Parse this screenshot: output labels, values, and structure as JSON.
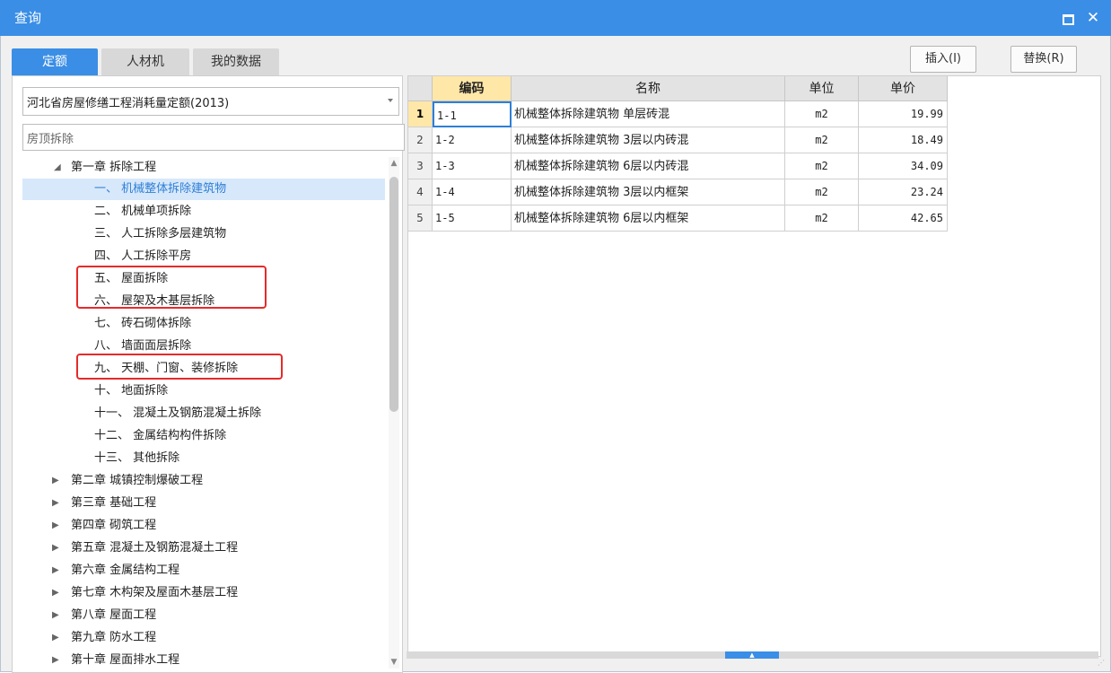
{
  "window": {
    "title": "查询"
  },
  "tabs": [
    {
      "label": "定额",
      "active": true
    },
    {
      "label": "人材机",
      "active": false
    },
    {
      "label": "我的数据",
      "active": false
    }
  ],
  "buttons": {
    "insert": "插入(I)",
    "replace": "替换(R)"
  },
  "quota_library": {
    "selected": "河北省房屋修缮工程消耗量定额(2013)"
  },
  "search": {
    "value": "房顶拆除"
  },
  "tree": {
    "chapter1": "第一章 拆除工程",
    "sections": [
      "一、 机械整体拆除建筑物",
      "二、 机械单项拆除",
      "三、 人工拆除多层建筑物",
      "四、 人工拆除平房",
      "五、 屋面拆除",
      "六、 屋架及木基层拆除",
      "七、 砖石砌体拆除",
      "八、 墙面面层拆除",
      "九、 天棚、门窗、装修拆除",
      "十、 地面拆除",
      "十一、 混凝土及钢筋混凝土拆除",
      "十二、 金属结构构件拆除",
      "十三、 其他拆除"
    ],
    "chapters": [
      "第二章 城镇控制爆破工程",
      "第三章 基础工程",
      "第四章 砌筑工程",
      "第五章 混凝土及钢筋混凝土工程",
      "第六章 金属结构工程",
      "第七章 木构架及屋面木基层工程",
      "第八章 屋面工程",
      "第九章 防水工程",
      "第十章 屋面排水工程"
    ]
  },
  "table": {
    "headers": [
      "编码",
      "名称",
      "单位",
      "单价"
    ],
    "rows": [
      {
        "n": "1",
        "code": "1-1",
        "name": "机械整体拆除建筑物 单层砖混",
        "unit": "m2",
        "price": "19.99"
      },
      {
        "n": "2",
        "code": "1-2",
        "name": "机械整体拆除建筑物 3层以内砖混",
        "unit": "m2",
        "price": "18.49"
      },
      {
        "n": "3",
        "code": "1-3",
        "name": "机械整体拆除建筑物 6层以内砖混",
        "unit": "m2",
        "price": "34.09"
      },
      {
        "n": "4",
        "code": "1-4",
        "name": "机械整体拆除建筑物 3层以内框架",
        "unit": "m2",
        "price": "23.24"
      },
      {
        "n": "5",
        "code": "1-5",
        "name": "机械整体拆除建筑物 6层以内框架",
        "unit": "m2",
        "price": "42.65"
      }
    ]
  },
  "icons": {
    "maximize": "maximize-icon",
    "close": "close-icon",
    "expand": "expand-triangle-icon",
    "collapse": "collapse-triangle-icon"
  },
  "colors": {
    "accent": "#3a8ee6",
    "highlight": "#e62a2a",
    "selected_row": "#d7e8fb"
  }
}
